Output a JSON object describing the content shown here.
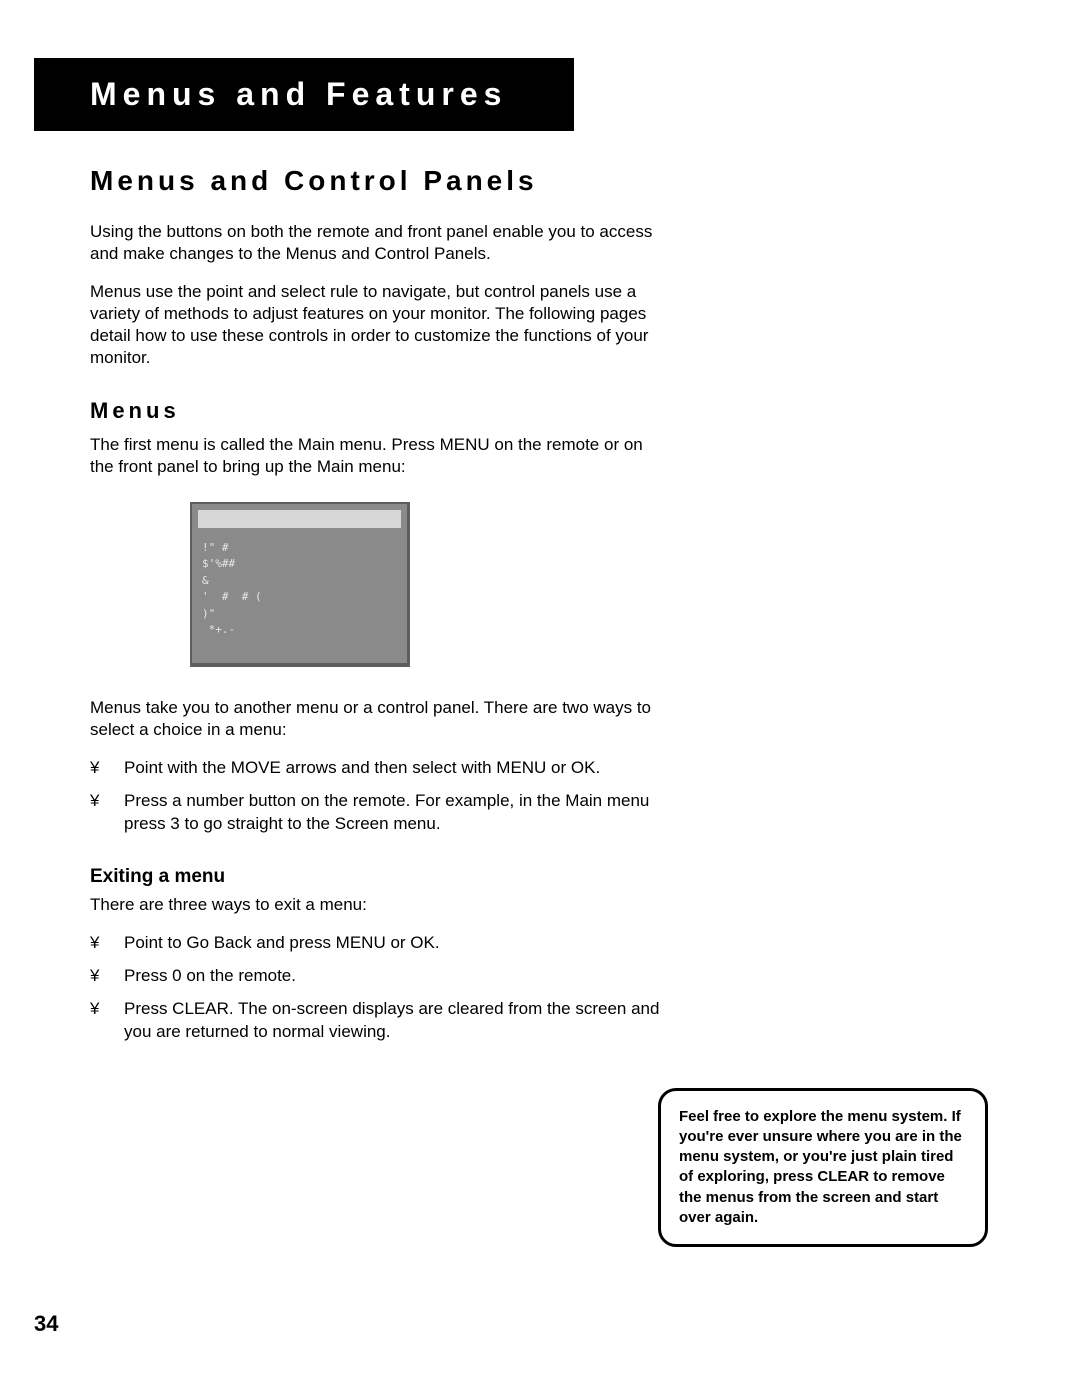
{
  "chapter_title": "Menus and Features",
  "section_title": "Menus and Control Panels",
  "intro_p1": "Using the buttons on both the remote and front panel enable you to access and make changes to the Menus and Control Panels.",
  "intro_p2": "Menus use the point and select rule to navigate, but control panels use a variety of methods to adjust features on your monitor. The following pages detail how to use these controls in order to customize the functions of your monitor.",
  "menus_heading": "Menus",
  "menus_p1": "The first menu is called the Main menu. Press MENU on the remote or on the front panel to bring up the Main menu:",
  "screen_lines": "!\" #\n$'%##\n&\n'  #  # (\n)\"\n *+.-",
  "menus_p2": "Menus take you to another menu or a control panel. There are two ways to select a choice in a menu:",
  "bullet_glyph": "¥",
  "menus_bullets": [
    "Point with the MOVE arrows and then select with MENU or OK.",
    "Press a number button on the remote. For example, in the Main menu press 3 to go straight to the Screen menu."
  ],
  "exit_heading": "Exiting a menu",
  "exit_p1": "There are three ways to exit a menu:",
  "exit_bullets": [
    "Point to Go Back and press MENU or OK.",
    "Press 0 on the remote.",
    "Press CLEAR. The on-screen displays are cleared from the screen and you are returned to normal viewing."
  ],
  "tip_text": "Feel free to explore the menu system. If you're ever unsure where you are in the menu system, or you're just plain tired of exploring, press CLEAR to remove the menus from the screen and start over again.",
  "page_number": "34"
}
